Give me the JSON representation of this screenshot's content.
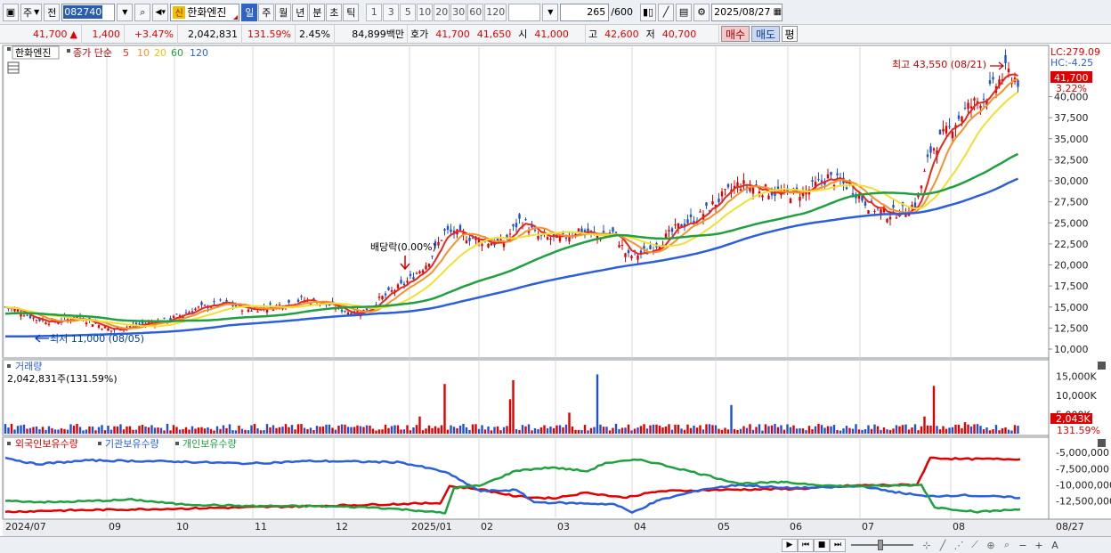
{
  "toolbar": {
    "period_label": "주",
    "prev_label": "전",
    "stock_code": "082740",
    "stock_badge": "신",
    "stock_name": "한화엔진",
    "periods": [
      "일",
      "주",
      "월",
      "년",
      "분",
      "초",
      "틱"
    ],
    "selected_period": "일",
    "intervals": [
      "1",
      "3",
      "5",
      "10",
      "20",
      "30",
      "60",
      "120"
    ],
    "count": "265",
    "count_total": "/600",
    "date": "2025/08/27"
  },
  "quote": {
    "price": "41,700",
    "price_arrow": "▲",
    "change": "1,400",
    "change_pct": "+3.47%",
    "volume": "2,042,831",
    "volume_ratio": "131.59%",
    "turnover": "2.45%",
    "amount": "84,899백만",
    "ask_label": "호가",
    "ask": "41,700",
    "bid": "41,650",
    "open_label": "시",
    "open": "41,000",
    "high_label": "고",
    "high": "42,600",
    "low_label": "저",
    "low": "40,700",
    "buy_label": "매수",
    "sell_label": "매도",
    "avg_label": "평"
  },
  "price_panel": {
    "legend_name": "한화엔진",
    "legend_ma": "종가 단순",
    "ma_periods": [
      "5",
      "10",
      "20",
      "60",
      "120"
    ],
    "ma_colors": [
      "#e8281e",
      "#f5922c",
      "#f0e030",
      "#20a040",
      "#2c5fd8"
    ],
    "lc": "LC:279.09",
    "hc": "HC:-4.25",
    "last_price": "41,700",
    "last_pct": "3.22%",
    "high_marker": "최고 43,550 (08/21)",
    "low_marker": "최저 11,000 (08/05)",
    "dividend_marker": "배당락(0.00%)",
    "axis": [
      "40,000",
      "37,500",
      "35,000",
      "32,500",
      "30,000",
      "27,500",
      "25,000",
      "22,500",
      "20,000",
      "17,500",
      "15,000",
      "12,500",
      "10,000"
    ]
  },
  "volume_panel": {
    "title": "거래량",
    "value": "2,042,831주(131.59%)",
    "axis": [
      "15,000K",
      "10,000K",
      "5,000K"
    ],
    "last_tag": "2,043K",
    "last_pct": "131.59%"
  },
  "holdings_panel": {
    "legend": [
      "외국인보유수량",
      "기관보유수량",
      "개인보유수량"
    ],
    "colors": [
      "#e00000",
      "#2c5fd8",
      "#20a040"
    ],
    "axis": [
      "-5,000,000",
      "-7,500,000",
      "-10,000,000",
      "-12,500,000"
    ]
  },
  "x_axis": [
    "2024/07",
    "09",
    "10",
    "11",
    "12",
    "2025/01",
    "02",
    "03",
    "04",
    "05",
    "06",
    "07",
    "08",
    "08/27"
  ],
  "chart_data": {
    "type": "line",
    "title": "한화엔진",
    "x_range": [
      "2024/07",
      "2025/08/27"
    ],
    "ylim": [
      10000,
      44000
    ],
    "series": [
      {
        "name": "종가",
        "x": [
          "2024/07",
          "2024/08/05",
          "2024/09",
          "2024/10",
          "2024/11",
          "2024/12",
          "2025/01",
          "2025/02",
          "2025/03",
          "2025/04",
          "2025/05",
          "2025/06",
          "2025/07",
          "2025/08/21",
          "2025/08/27"
        ],
        "values": [
          15000,
          11000,
          12800,
          14200,
          15200,
          14000,
          18500,
          24000,
          23200,
          21000,
          29500,
          28800,
          26000,
          43550,
          41700
        ]
      },
      {
        "name": "120",
        "values": [
          11500,
          12300,
          13000,
          13500,
          14000,
          14600,
          15300,
          16800,
          18200,
          19500,
          21500,
          23500,
          25300,
          27500,
          28800
        ]
      }
    ]
  }
}
